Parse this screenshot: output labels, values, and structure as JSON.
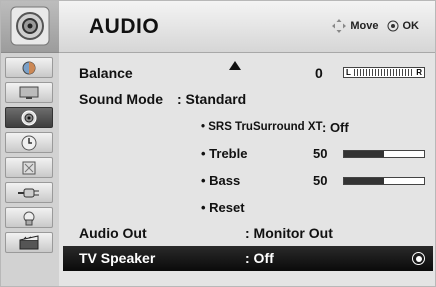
{
  "header": {
    "title": "AUDIO",
    "move_label": "Move",
    "ok_label": "OK"
  },
  "sidebar": {
    "items": [
      {
        "icon": "picture-icon"
      },
      {
        "icon": "screen-icon"
      },
      {
        "icon": "audio-icon",
        "active": true
      },
      {
        "icon": "time-icon"
      },
      {
        "icon": "option-icon"
      },
      {
        "icon": "input-icon"
      },
      {
        "icon": "lock-icon"
      },
      {
        "icon": "media-icon"
      }
    ]
  },
  "menu": {
    "balance": {
      "label": "Balance",
      "value": "0",
      "left_mark": "L",
      "right_mark": "R",
      "position": 0
    },
    "sound_mode": {
      "label": "Sound Mode",
      "value": ": Standard"
    },
    "srs": {
      "label": "• SRS TruSurround XT",
      "value": ": Off"
    },
    "treble": {
      "label": "• Treble",
      "value": "50",
      "level": 0.5
    },
    "bass": {
      "label": "• Bass",
      "value": "50",
      "level": 0.5
    },
    "reset": {
      "label": "• Reset"
    },
    "audio_out": {
      "label": "Audio Out",
      "value": ": Monitor Out"
    },
    "tv_speaker": {
      "label": "TV Speaker",
      "value": ": Off"
    }
  },
  "colors": {
    "highlight": "#111111",
    "sidebar_active": "#4a4a4a",
    "background": "#e4e4e4"
  }
}
